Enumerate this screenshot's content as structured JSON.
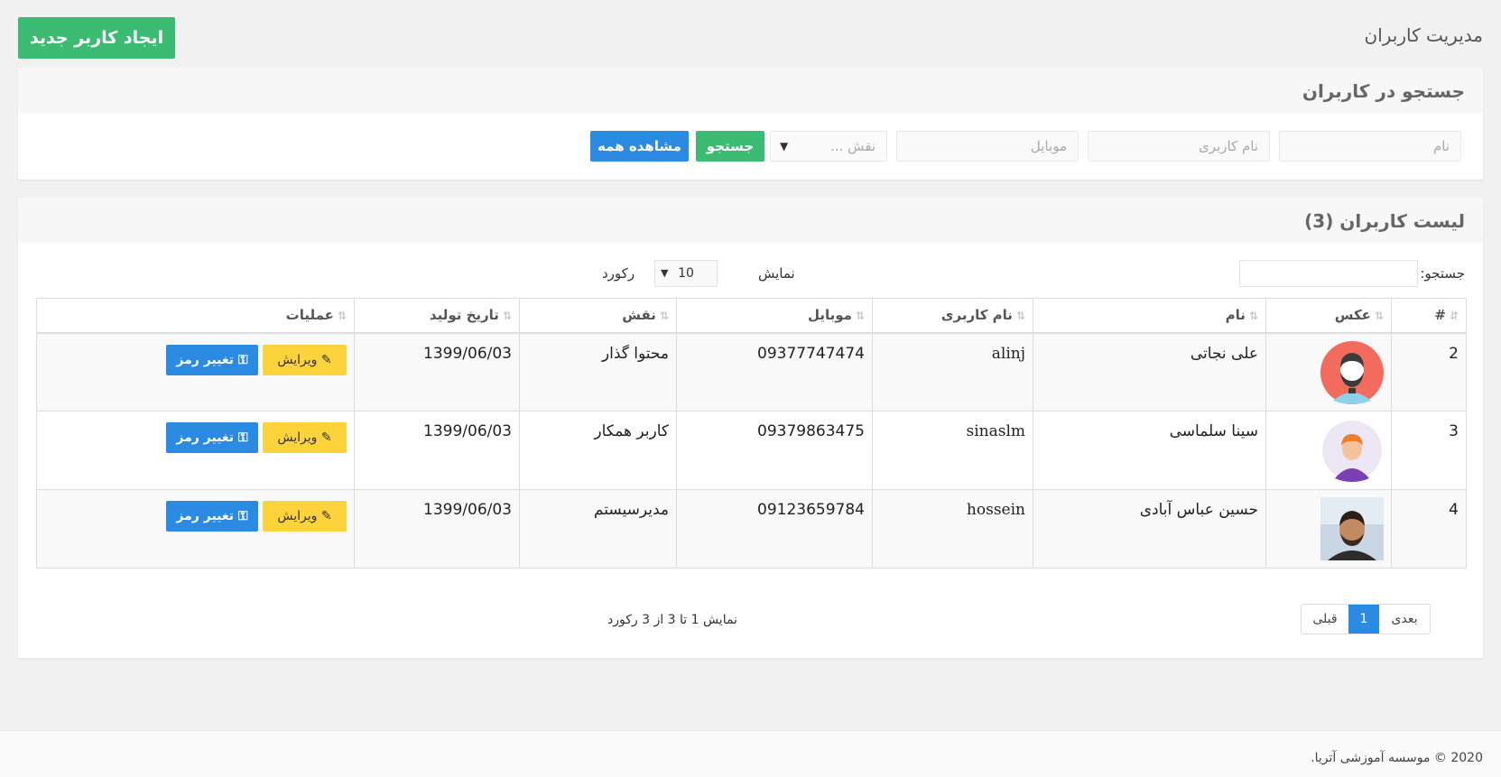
{
  "header": {
    "title": "مدیریت کاربران",
    "create_label": "ایجاد کاربر جدید"
  },
  "search": {
    "title": "جستجو در کاربران",
    "name_placeholder": "نام",
    "username_placeholder": "نام کاربری",
    "mobile_placeholder": "موبایل",
    "role_placeholder": "نقش ...",
    "search_label": "جستجو",
    "all_label": "مشاهده همه"
  },
  "list": {
    "title": "لیست کاربران (3)",
    "filter_label": "جستجو:",
    "show_label": "نمایش",
    "page_length": "10",
    "record_label": "رکورد",
    "columns": [
      "#",
      "عکس",
      "نام",
      "نام کاربری",
      "موبایل",
      "نقش",
      "تاریخ تولید",
      "عملیات"
    ],
    "rows": [
      {
        "id": "2",
        "name": "علی نجاتی",
        "username": "alinj",
        "mobile": "09377747474",
        "role": "محتوا گذار",
        "date": "1399/06/03",
        "avatar": "avatar-man-beard"
      },
      {
        "id": "3",
        "name": "سینا سلماسی",
        "username": "sinaslm",
        "mobile": "09379863475",
        "role": "کاربر همکار",
        "date": "1399/06/03",
        "avatar": "avatar-boy"
      },
      {
        "id": "4",
        "name": "حسین عباس آبادی",
        "username": "hossein",
        "mobile": "09123659784",
        "role": "مدیرسیستم",
        "date": "1399/06/03",
        "avatar": "avatar-photo"
      }
    ],
    "edit_label": "ویرایش",
    "password_label": "تغییر رمز",
    "info": "نمایش 1 تا 3 از 3 رکورد",
    "pager": {
      "prev": "قبلی",
      "current": "1",
      "next": "بعدی"
    }
  },
  "footer": {
    "text": "2020 © موسسه آموزشی آتریا."
  },
  "colors": {
    "green": "#3cbb72",
    "blue": "#2b8ae2",
    "yellow": "#fdd33c"
  }
}
